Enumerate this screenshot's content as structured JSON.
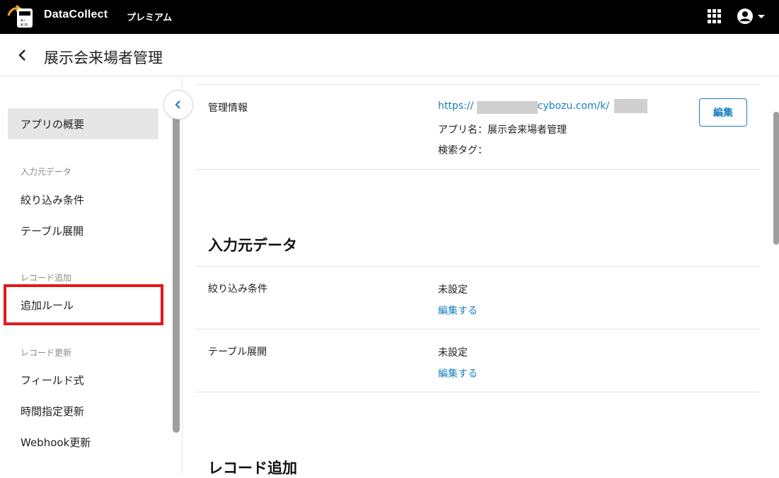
{
  "topbar": {
    "brand": "DataCollect",
    "plan": "プレミアム",
    "apps_icon": "apps-grid-icon",
    "account_icon": "account-circle-icon"
  },
  "header": {
    "back_icon": "chevron-left-icon",
    "title": "展示会来場者管理"
  },
  "sidebar": {
    "items": [
      {
        "label": "アプリの概要",
        "active": true
      },
      {
        "section": "入力元データ"
      },
      {
        "label": "絞り込み条件"
      },
      {
        "label": "テーブル展開"
      },
      {
        "section": "レコード追加"
      },
      {
        "label": "追加ルール",
        "highlighted": true
      },
      {
        "section": "レコード更新"
      },
      {
        "label": "フィールド式"
      },
      {
        "label": "時間指定更新"
      },
      {
        "label": "Webhook更新"
      }
    ],
    "collapse_icon": "chevron-left-icon"
  },
  "main": {
    "admin_info": {
      "label": "管理情報",
      "url_prefix": "https://",
      "url_domain": ".cybozu.com/k/",
      "app_name": "アプリ名：展示会来場者管理",
      "search_tag": "検索タグ：",
      "edit_button": "編集"
    },
    "input_section": {
      "title": "入力元データ",
      "rows": [
        {
          "label": "絞り込み条件",
          "value": "未設定",
          "link": "編集する"
        },
        {
          "label": "テーブル展開",
          "value": "未設定",
          "link": "編集する"
        }
      ]
    },
    "record_add_section": {
      "title": "レコード追加"
    }
  },
  "colors": {
    "topbar_bg": "#000000",
    "link": "#1a7fc1",
    "highlight": "#e0191e",
    "active_item_bg": "#e6e6e6"
  }
}
